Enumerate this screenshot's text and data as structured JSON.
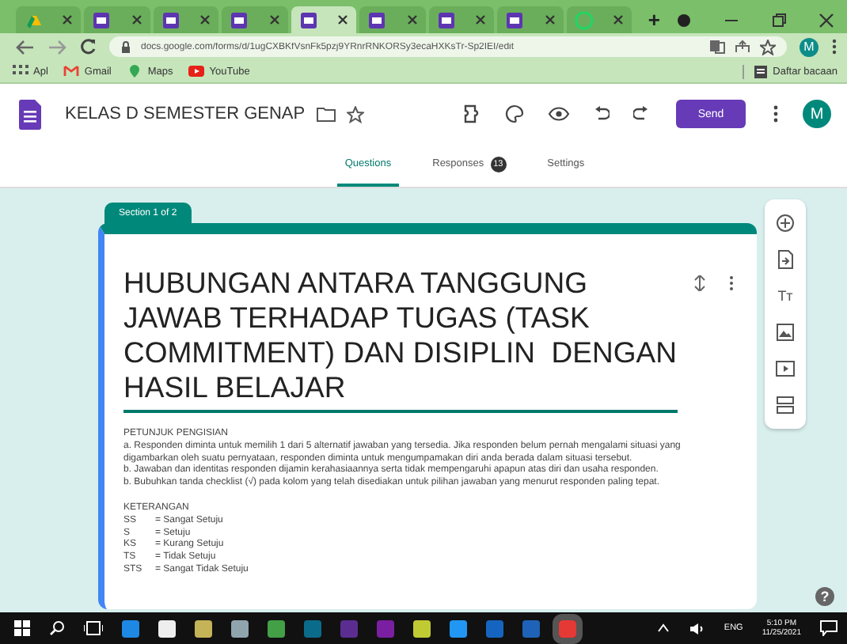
{
  "browser": {
    "tabs": [
      {
        "kind": "drive",
        "selected": false
      },
      {
        "kind": "forms",
        "selected": false
      },
      {
        "kind": "forms",
        "selected": false
      },
      {
        "kind": "forms",
        "selected": false
      },
      {
        "kind": "forms",
        "selected": true
      },
      {
        "kind": "forms",
        "selected": false
      },
      {
        "kind": "forms",
        "selected": false
      },
      {
        "kind": "forms",
        "selected": false
      },
      {
        "kind": "whatsapp",
        "selected": false
      }
    ],
    "new_tab": "+",
    "url": "docs.google.com/forms/d/1ugCXBKfVsnFk5pzj9YRnrRNKORSy3ecaHXKsTr-Sp2IEI/edit",
    "profile": "M",
    "bookmarks": [
      {
        "kind": "apps",
        "label": "Apl"
      },
      {
        "kind": "gmail",
        "label": "Gmail"
      },
      {
        "kind": "maps",
        "label": "Maps"
      },
      {
        "kind": "youtube",
        "label": "YouTube"
      }
    ],
    "reading_list": "Daftar bacaan"
  },
  "form_header": {
    "title": "KELAS D SEMESTER GENAP",
    "send": "Send",
    "avatar": "M"
  },
  "nav_tabs": [
    {
      "label": "Questions",
      "selected": true
    },
    {
      "label": "Responses",
      "selected": false,
      "badge": "13"
    },
    {
      "label": "Settings",
      "selected": false
    }
  ],
  "section": {
    "label": "Section 1 of 2",
    "title": "HUBUNGAN ANTARA TANGGUNG JAWAB TERHADAP TUGAS (TASK COMMITMENT) DAN DISIPLIN  DENGAN HASIL BELAJAR",
    "instructions_heading": "PETUNJUK PENGISIAN",
    "instructions": [
      "a. Responden diminta untuk memilih 1 dari 5 alternatif jawaban yang tersedia. Jika responden belum pernah mengalami situasi yang digambarkan oleh suatu pernyataan, responden diminta untuk mengumpamakan diri anda berada dalam situasi tersebut.",
      "b. Jawaban dan identitas responden dijamin kerahasiaannya serta tidak mempengaruhi apapun atas diri dan usaha responden.",
      "b. Bubuhkan tanda checklist (√) pada kolom yang telah disediakan untuk pilihan jawaban yang menurut responden paling tepat."
    ],
    "legend_heading": "KETERANGAN",
    "legend": [
      {
        "code": "SS",
        "meaning": "= Sangat Setuju"
      },
      {
        "code": "S",
        "meaning": "= Setuju"
      },
      {
        "code": "KS",
        "meaning": "= Kurang Setuju"
      },
      {
        "code": "TS",
        "meaning": "= Tidak Setuju"
      },
      {
        "code": "STS",
        "meaning": "= Sangat Tidak Setuju"
      }
    ]
  },
  "toolbar": [
    {
      "kind": "add"
    },
    {
      "kind": "import"
    },
    {
      "kind": "title",
      "label": "Tт"
    },
    {
      "kind": "image"
    },
    {
      "kind": "video"
    },
    {
      "kind": "section"
    }
  ],
  "help": "?",
  "taskbar": {
    "apps": [
      {
        "color": "#1e88e5",
        "selected": false
      },
      {
        "color": "#eeeeee",
        "selected": false
      },
      {
        "color": "#c5b358",
        "selected": false
      },
      {
        "color": "#90a4ae",
        "selected": false
      },
      {
        "color": "#43a047",
        "selected": false
      },
      {
        "color": "#0b6b8a",
        "selected": false
      },
      {
        "color": "#5c2d91",
        "selected": false
      },
      {
        "color": "#7b1fa2",
        "selected": false
      },
      {
        "color": "#c0ca33",
        "selected": false
      },
      {
        "color": "#2196f3",
        "selected": false
      },
      {
        "color": "#1565c0",
        "selected": false
      },
      {
        "color": "#1e63b8",
        "selected": false
      },
      {
        "color": "#e53935",
        "selected": true
      }
    ],
    "language": "ENG",
    "time": "5:10 PM",
    "date": "11/25/2021"
  }
}
